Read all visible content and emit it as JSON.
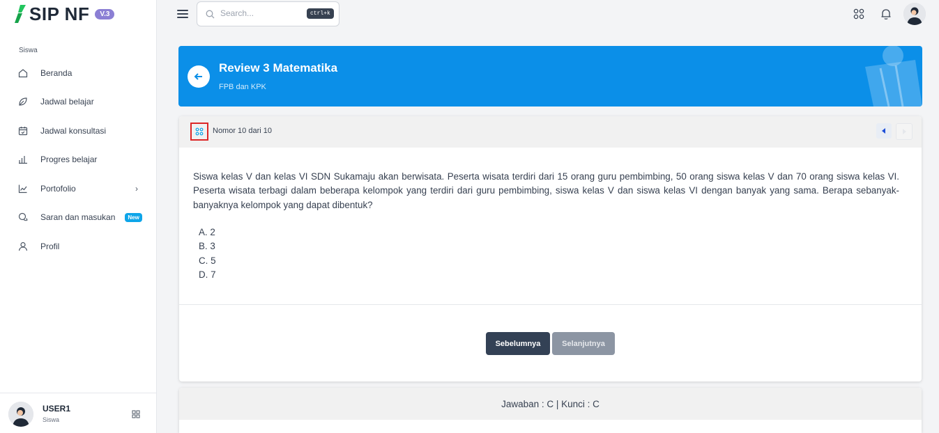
{
  "app": {
    "logo_text": "SIP NF",
    "version_badge": "V.3"
  },
  "sidebar": {
    "section_label": "Siswa",
    "items": [
      {
        "label": "Beranda",
        "icon": "home-icon"
      },
      {
        "label": "Jadwal belajar",
        "icon": "leaf-icon"
      },
      {
        "label": "Jadwal konsultasi",
        "icon": "calendar-check-icon"
      },
      {
        "label": "Progres belajar",
        "icon": "bar-chart-icon"
      },
      {
        "label": "Portofolio",
        "icon": "line-chart-icon",
        "chevron": "›"
      },
      {
        "label": "Saran dan masukan",
        "icon": "chat-icon",
        "badge": "New"
      },
      {
        "label": "Profil",
        "icon": "user-icon"
      }
    ],
    "footer": {
      "user_name": "USER1",
      "role": "Siswa"
    }
  },
  "topbar": {
    "search_placeholder": "Search...",
    "shortcut": "ctrl+k"
  },
  "banner": {
    "title": "Review 3 Matematika",
    "subtitle": "FPB dan KPK"
  },
  "question_card": {
    "nomor": "Nomor 10 dari 10",
    "text": "Siswa kelas V dan kelas VI SDN Sukamaju akan berwisata. Peserta wisata terdiri dari 15 orang guru pembimbing, 50 orang siswa kelas V dan 70 orang siswa kelas VI. Peserta wisata terbagi dalam beberapa kelompok yang terdiri dari guru pembimbing, siswa kelas V dan siswa  kelas VI dengan banyak yang sama. Berapa sebanyak-banyaknya kelompok yang dapat dibentuk?",
    "options": [
      "A. 2",
      "B. 3",
      "C. 5",
      "D. 7"
    ],
    "prev_label": "Sebelumnya",
    "next_label": "Selanjutnya"
  },
  "answer_card": {
    "summary": "Jawaban : C | Kunci : C"
  },
  "colors": {
    "banner_blue": "#0b8fe8",
    "primary_dark": "#334155",
    "disabled_gray": "#8c95a3",
    "badge_purple": "#8b7fd4",
    "badge_new": "#0ea5e9",
    "logo_green": "#22c55e"
  }
}
